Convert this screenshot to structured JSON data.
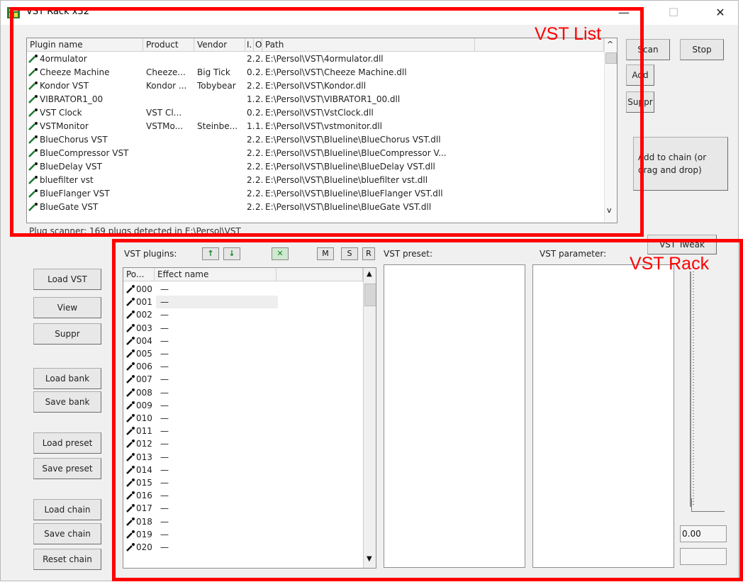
{
  "window": {
    "title": "VST Rack x32",
    "controls": {
      "minimize": "—",
      "maximize": "☐",
      "close": "✕"
    }
  },
  "annotations": {
    "list_label": "VST List",
    "rack_label": "VST Rack",
    "color": "#ff0000"
  },
  "plugin_list": {
    "columns": [
      "Plugin name",
      "Product",
      "Vendor",
      "I.",
      "O",
      "Path"
    ],
    "rows": [
      {
        "name": "4ormulator",
        "product": "",
        "vendor": "",
        "i": "2.",
        "o": "2.",
        "path": "E:\\Persol\\VST\\4ormulator.dll"
      },
      {
        "name": "Cheeze Machine",
        "product": "Cheeze...",
        "vendor": "Big Tick",
        "i": "0.",
        "o": "2.",
        "path": "E:\\Persol\\VST\\Cheeze Machine.dll"
      },
      {
        "name": "Kondor VST",
        "product": "Kondor ...",
        "vendor": "Tobybear",
        "i": "2.",
        "o": "2.",
        "path": "E:\\Persol\\VST\\Kondor.dll"
      },
      {
        "name": "VIBRATOR1_00",
        "product": "",
        "vendor": "",
        "i": "1.",
        "o": "2.",
        "path": "E:\\Persol\\VST\\VIBRATOR1_00.dll"
      },
      {
        "name": "VST Clock",
        "product": "VST Cl...",
        "vendor": "",
        "i": "0.",
        "o": "2.",
        "path": "E:\\Persol\\VST\\VstClock.dll"
      },
      {
        "name": "VSTMonitor",
        "product": "VSTMo...",
        "vendor": "Steinbe...",
        "i": "1.",
        "o": "1.",
        "path": "E:\\Persol\\VST\\vstmonitor.dll"
      },
      {
        "name": "BlueChorus VST",
        "product": "",
        "vendor": "",
        "i": "2.",
        "o": "2.",
        "path": "E:\\Persol\\VST\\Blueline\\BlueChorus VST.dll"
      },
      {
        "name": "BlueCompressor VST",
        "product": "",
        "vendor": "",
        "i": "2.",
        "o": "2.",
        "path": "E:\\Persol\\VST\\Blueline\\BlueCompressor V..."
      },
      {
        "name": "BlueDelay VST",
        "product": "",
        "vendor": "",
        "i": "2.",
        "o": "2.",
        "path": "E:\\Persol\\VST\\Blueline\\BlueDelay VST.dll"
      },
      {
        "name": "bluefilter vst",
        "product": "",
        "vendor": "",
        "i": "2.",
        "o": "2.",
        "path": "E:\\Persol\\VST\\Blueline\\bluefilter vst.dll"
      },
      {
        "name": "BlueFlanger VST",
        "product": "",
        "vendor": "",
        "i": "2.",
        "o": "2.",
        "path": "E:\\Persol\\VST\\Blueline\\BlueFlanger VST.dll"
      },
      {
        "name": "BlueGate VST",
        "product": "",
        "vendor": "",
        "i": "2.",
        "o": "2.",
        "path": "E:\\Persol\\VST\\Blueline\\BlueGate VST.dll"
      }
    ]
  },
  "status": "Plug scanner: 169 plugs detected in E:\\Persol\\VST",
  "right_buttons": {
    "scan": "Scan",
    "stop": "Stop",
    "add": "Add",
    "suppr": "Suppr",
    "add_to_chain": "Add to chain   (or drag and drop)",
    "vst_tweak": "VST Tweak"
  },
  "left_buttons": {
    "load_vst": "Load VST",
    "view": "View",
    "suppr": "Suppr",
    "load_bank": "Load bank",
    "save_bank": "Save bank",
    "load_preset": "Load preset",
    "save_preset": "Save preset",
    "load_chain": "Load chain",
    "save_chain": "Save chain",
    "reset_chain": "Reset chain"
  },
  "rack": {
    "plugins_label": "VST plugins:",
    "up_label": "↑",
    "down_label": "↓",
    "remove_label": "✕",
    "m_label": "M",
    "s_label": "S",
    "r_label": "R",
    "preset_label": "VST preset:",
    "parameter_label": "VST parameter:",
    "columns": [
      "Po...",
      "Effect name"
    ],
    "slots": [
      "000",
      "001",
      "002",
      "003",
      "004",
      "005",
      "006",
      "007",
      "008",
      "009",
      "010",
      "011",
      "012",
      "013",
      "014",
      "015",
      "016",
      "017",
      "018",
      "019",
      "020"
    ],
    "empty_name": "—",
    "selected_slot": "001",
    "param_value": "0.00"
  },
  "colors": {
    "plugin_icon": "#1a7a2a",
    "arrow_green": "#0d8a22"
  }
}
